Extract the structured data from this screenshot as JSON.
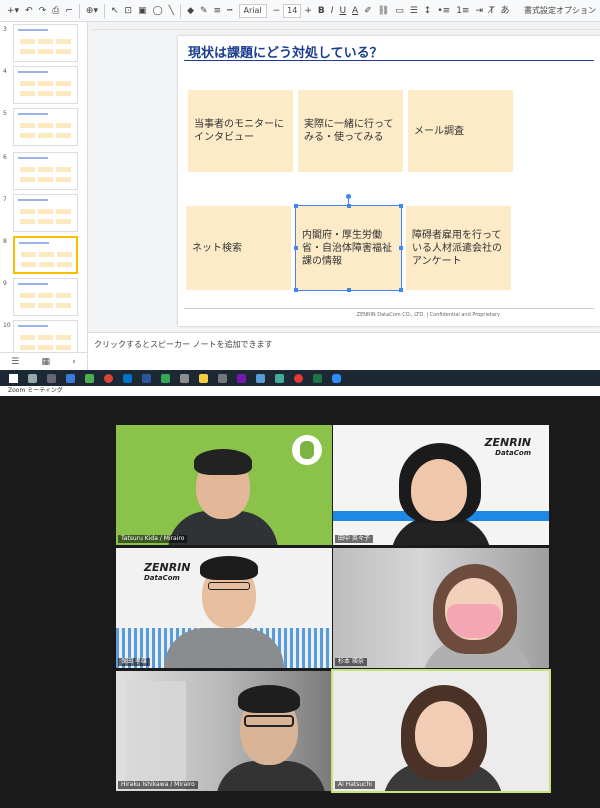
{
  "toolbar": {
    "font": "Arial",
    "font_size": "14",
    "bold": "B",
    "italic": "I",
    "underline": "U",
    "text_color": "A",
    "input_tools": "あ",
    "options": "書式設定オプション"
  },
  "filmstrip": {
    "slide_numbers": [
      "3",
      "4",
      "5",
      "6",
      "7",
      "8",
      "9",
      "10"
    ],
    "selected_index": 5
  },
  "slide": {
    "title": "現状は課題にどう対処している？",
    "cards": [
      "当事者のモニターにインタビュー",
      "実際に一緒に行ってみる・使ってみる",
      "メール調査",
      "ネット検索",
      "内閣府・厚生労働省・自治体障害福祉課の情報",
      "障碍者雇用を行っている人材派遣会社のアンケート"
    ],
    "footer": "ZENRIN DataCom CO., LTD.  |  Confidential and Proprietary"
  },
  "notes": {
    "placeholder": "クリックするとスピーカー ノートを追加できます"
  },
  "zoom": {
    "title": "Zoom ミーティング",
    "participants": [
      {
        "name": "Tatsuru Kida / Mirairo",
        "speaking": false
      },
      {
        "name": "田中 英々子",
        "speaking": false
      },
      {
        "name": "保田 孝雄",
        "speaking": false
      },
      {
        "name": "杉本 瑛奈",
        "speaking": false
      },
      {
        "name": "Hiraku Ishikawa / Mirairo",
        "speaking": false
      },
      {
        "name": "Ai Hatsuchi",
        "speaking": true
      }
    ],
    "brand_logo_line1": "ZENRIN",
    "brand_logo_line2": "DataCom"
  },
  "colors": {
    "slide_title": "#1a3d8f",
    "card_fill": "#fdebc8",
    "selection": "#4285f4",
    "speaking_border": "#c6e27a",
    "green_background": "#8bc34a"
  }
}
